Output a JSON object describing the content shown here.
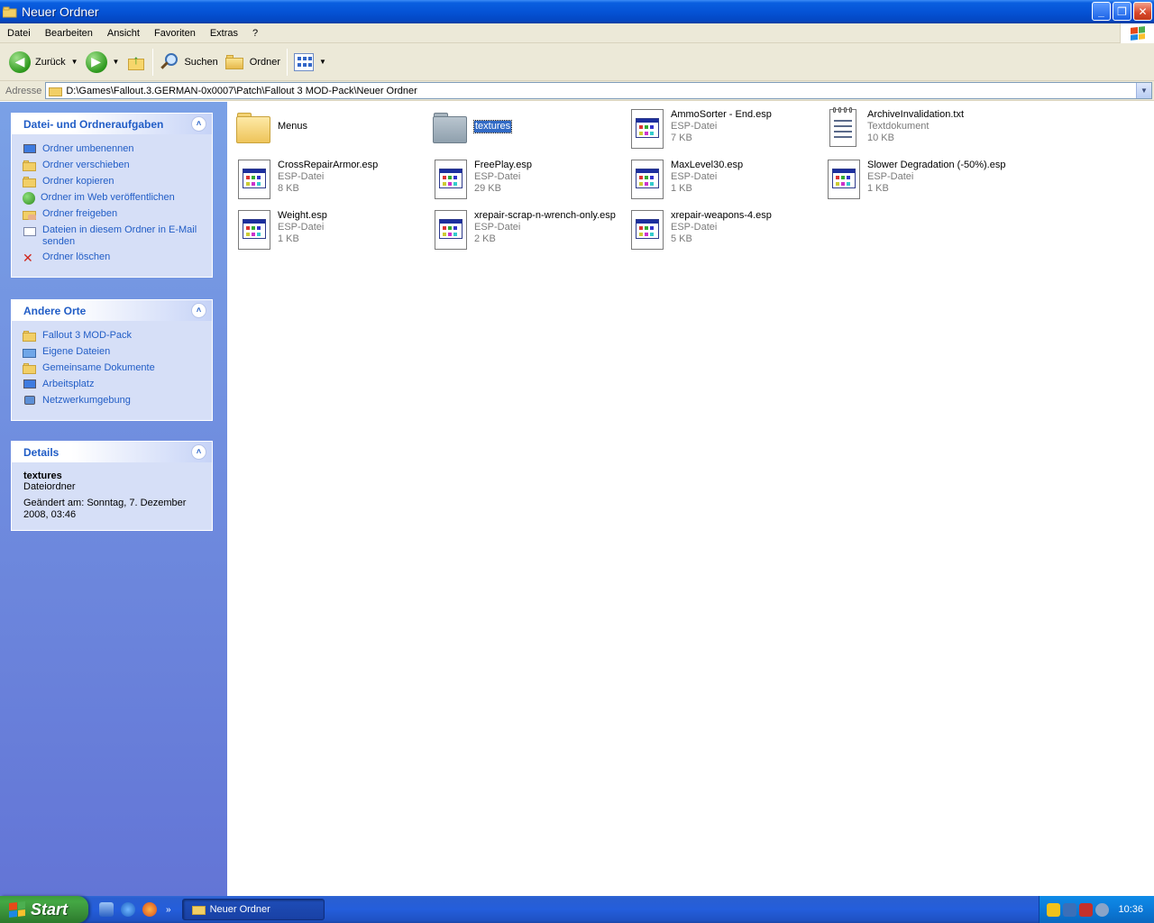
{
  "window": {
    "title": "Neuer Ordner",
    "minimize": "_",
    "maximize": "❐",
    "close": "✕"
  },
  "menu": [
    "Datei",
    "Bearbeiten",
    "Ansicht",
    "Favoriten",
    "Extras",
    "?"
  ],
  "toolbar": {
    "back_label": "Zurück",
    "search_label": "Suchen",
    "folders_label": "Ordner"
  },
  "address": {
    "label": "Adresse",
    "value": "D:\\Games\\Fallout.3.GERMAN-0x0007\\Patch\\Fallout 3 MOD-Pack\\Neuer Ordner"
  },
  "tasks_panel": {
    "title": "Datei- und Ordneraufgaben",
    "items": [
      {
        "label": "Ordner umbenennen",
        "icon": "rename-icon"
      },
      {
        "label": "Ordner verschieben",
        "icon": "move-folder-icon"
      },
      {
        "label": "Ordner kopieren",
        "icon": "copy-folder-icon"
      },
      {
        "label": "Ordner im Web veröffentlichen",
        "icon": "globe-icon"
      },
      {
        "label": "Ordner freigeben",
        "icon": "share-folder-icon"
      },
      {
        "label": "Dateien in diesem Ordner in E-Mail senden",
        "icon": "mail-icon"
      },
      {
        "label": "Ordner löschen",
        "icon": "delete-icon"
      }
    ]
  },
  "places_panel": {
    "title": "Andere Orte",
    "items": [
      {
        "label": "Fallout 3 MOD-Pack",
        "icon": "folder-icon"
      },
      {
        "label": "Eigene Dateien",
        "icon": "my-documents-icon"
      },
      {
        "label": "Gemeinsame Dokumente",
        "icon": "shared-documents-icon"
      },
      {
        "label": "Arbeitsplatz",
        "icon": "my-computer-icon"
      },
      {
        "label": "Netzwerkumgebung",
        "icon": "network-icon"
      }
    ]
  },
  "details_panel": {
    "title": "Details",
    "name": "textures",
    "type": "Dateiordner",
    "modified": "Geändert am: Sonntag, 7. Dezember 2008, 03:46"
  },
  "files": [
    {
      "name": "Menus",
      "type": "",
      "size": "",
      "kind": "folder"
    },
    {
      "name": "textures",
      "type": "",
      "size": "",
      "kind": "folder-selected"
    },
    {
      "name": "AmmoSorter - End.esp",
      "type": "ESP-Datei",
      "size": "7 KB",
      "kind": "esp"
    },
    {
      "name": "ArchiveInvalidation.txt",
      "type": "Textdokument",
      "size": "10 KB",
      "kind": "txt"
    },
    {
      "name": "CrossRepairArmor.esp",
      "type": "ESP-Datei",
      "size": "8 KB",
      "kind": "esp"
    },
    {
      "name": "FreePlay.esp",
      "type": "ESP-Datei",
      "size": "29 KB",
      "kind": "esp"
    },
    {
      "name": "MaxLevel30.esp",
      "type": "ESP-Datei",
      "size": "1 KB",
      "kind": "esp"
    },
    {
      "name": "Slower Degradation (-50%).esp",
      "type": "ESP-Datei",
      "size": "1 KB",
      "kind": "esp"
    },
    {
      "name": "Weight.esp",
      "type": "ESP-Datei",
      "size": "1 KB",
      "kind": "esp"
    },
    {
      "name": "xrepair-scrap-n-wrench-only.esp",
      "type": "ESP-Datei",
      "size": "2 KB",
      "kind": "esp"
    },
    {
      "name": "xrepair-weapons-4.esp",
      "type": "ESP-Datei",
      "size": "5 KB",
      "kind": "esp"
    }
  ],
  "taskbar": {
    "start_label": "Start",
    "quicklaunch_more": "»",
    "task_item": "Neuer Ordner",
    "clock": "10:36"
  },
  "colors": {
    "link": "#215dc6",
    "selection": "#316ac5",
    "taskbar": "#245edb",
    "start": "#3a913a"
  }
}
